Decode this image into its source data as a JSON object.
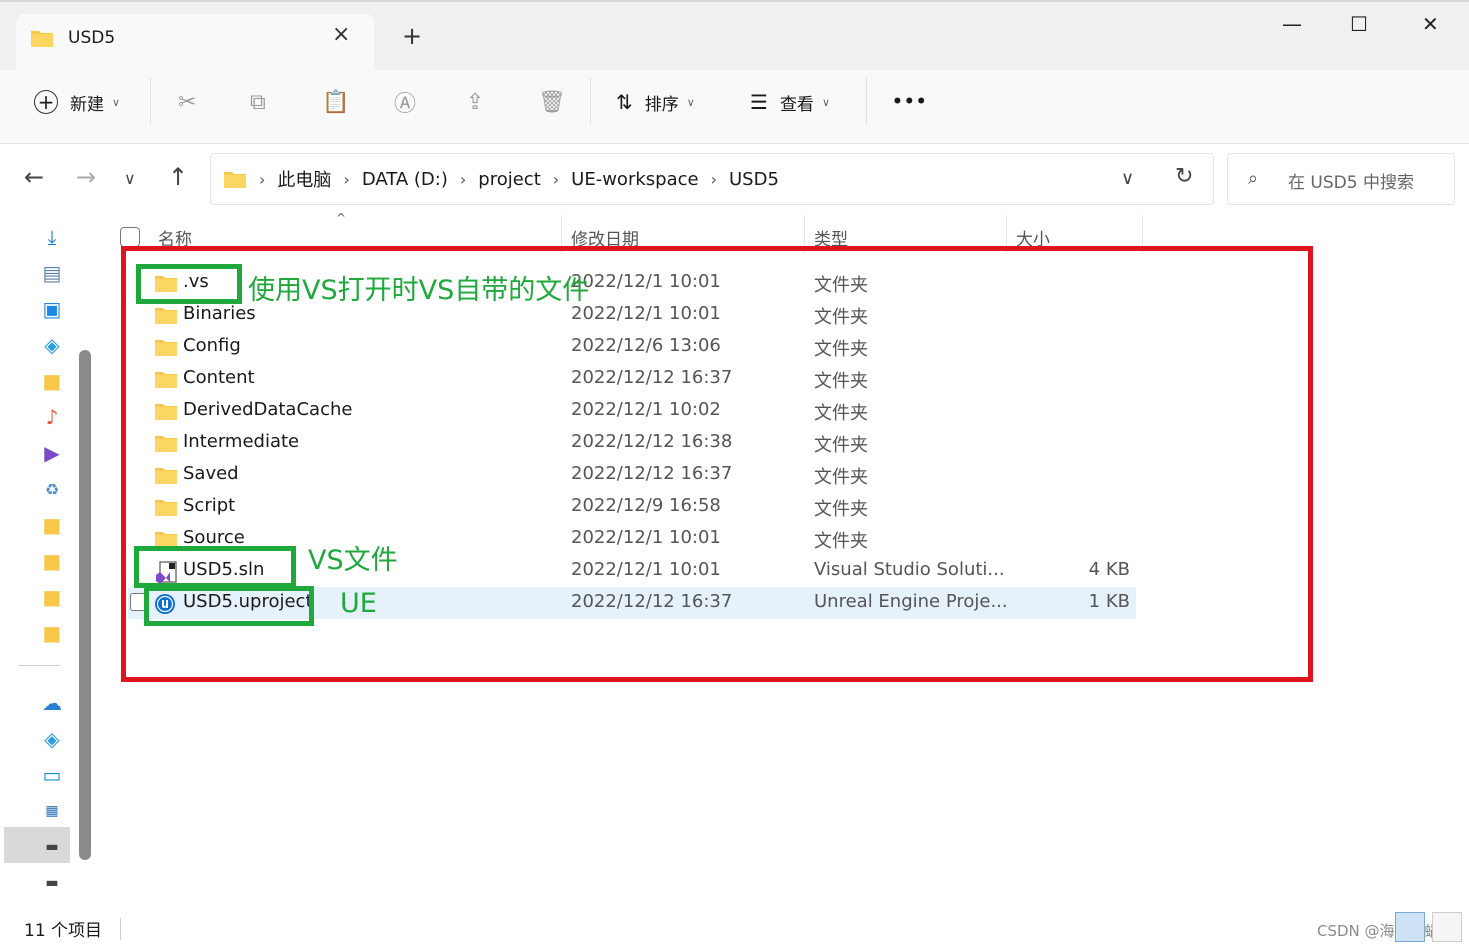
{
  "window": {
    "tab_title": "USD5",
    "new_tab": "+",
    "minimize": "—",
    "maximize": "☐",
    "close": "✕"
  },
  "toolbar": {
    "new_label": "新建",
    "sort_label": "排序",
    "view_label": "查看",
    "more_label": "•••"
  },
  "breadcrumb": {
    "items": [
      "此电脑",
      "DATA (D:)",
      "project",
      "UE-workspace",
      "USD5"
    ]
  },
  "search": {
    "placeholder": "在 USD5 中搜索"
  },
  "columns": {
    "name": "名称",
    "date": "修改日期",
    "type": "类型",
    "size": "大小"
  },
  "files": [
    {
      "name": ".vs",
      "date": "2022/12/1 10:01",
      "type": "文件夹",
      "size": "",
      "kind": "folder"
    },
    {
      "name": "Binaries",
      "date": "2022/12/1 10:01",
      "type": "文件夹",
      "size": "",
      "kind": "folder"
    },
    {
      "name": "Config",
      "date": "2022/12/6 13:06",
      "type": "文件夹",
      "size": "",
      "kind": "folder"
    },
    {
      "name": "Content",
      "date": "2022/12/12 16:37",
      "type": "文件夹",
      "size": "",
      "kind": "folder"
    },
    {
      "name": "DerivedDataCache",
      "date": "2022/12/1 10:02",
      "type": "文件夹",
      "size": "",
      "kind": "folder"
    },
    {
      "name": "Intermediate",
      "date": "2022/12/12 16:38",
      "type": "文件夹",
      "size": "",
      "kind": "folder"
    },
    {
      "name": "Saved",
      "date": "2022/12/12 16:37",
      "type": "文件夹",
      "size": "",
      "kind": "folder"
    },
    {
      "name": "Script",
      "date": "2022/12/9 16:58",
      "type": "文件夹",
      "size": "",
      "kind": "folder"
    },
    {
      "name": "Source",
      "date": "2022/12/1 10:01",
      "type": "文件夹",
      "size": "",
      "kind": "folder"
    },
    {
      "name": "USD5.sln",
      "date": "2022/12/1 10:01",
      "type": "Visual Studio Soluti...",
      "size": "4 KB",
      "kind": "sln"
    },
    {
      "name": "USD5.uproject",
      "date": "2022/12/12 16:37",
      "type": "Unreal Engine Proje...",
      "size": "1 KB",
      "kind": "uproject"
    }
  ],
  "annotations": {
    "vs_folder": "使用VS打开时VS自带的文件",
    "vs_file": "VS文件",
    "ue_file": "UE"
  },
  "status": {
    "item_count": "11 个项目"
  },
  "watermark": "CSDN @海蓝小蜗"
}
